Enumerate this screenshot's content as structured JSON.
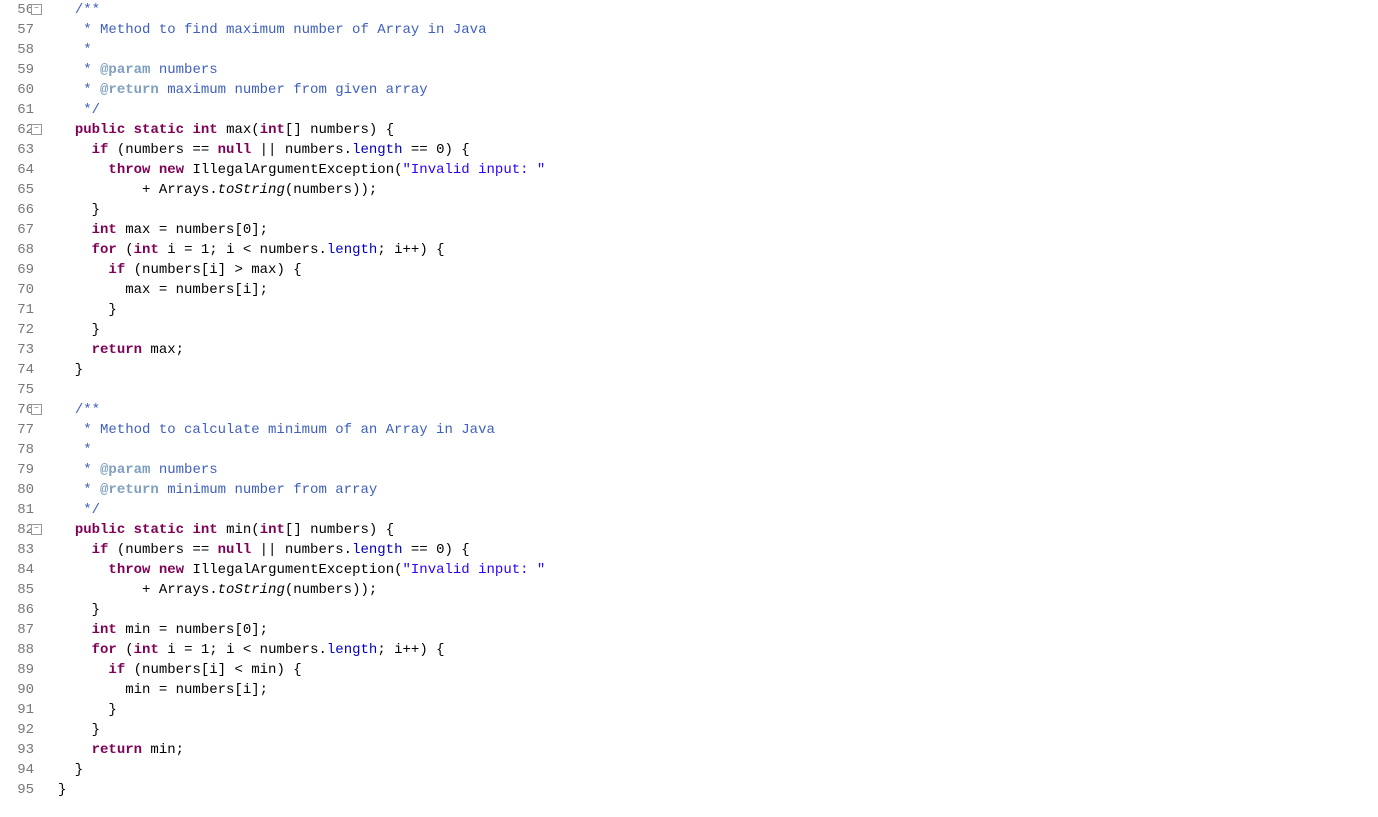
{
  "gutter": {
    "start": 56,
    "end": 95,
    "foldable": [
      56,
      62,
      76,
      82
    ]
  },
  "lines": {
    "56": [
      {
        "t": "  ",
        "c": ""
      },
      {
        "t": "/**",
        "c": "javadoc"
      }
    ],
    "57": [
      {
        "t": "   * Method to find maximum number of Array in Java",
        "c": "javadoc"
      }
    ],
    "58": [
      {
        "t": "   * ",
        "c": "javadoc"
      }
    ],
    "59": [
      {
        "t": "   * ",
        "c": "javadoc"
      },
      {
        "t": "@param",
        "c": "javadoc-tag"
      },
      {
        "t": " numbers",
        "c": "javadoc"
      }
    ],
    "60": [
      {
        "t": "   * ",
        "c": "javadoc"
      },
      {
        "t": "@return",
        "c": "javadoc-tag"
      },
      {
        "t": " maximum number from given array",
        "c": "javadoc"
      }
    ],
    "61": [
      {
        "t": "   */",
        "c": "javadoc"
      }
    ],
    "62": [
      {
        "t": "  ",
        "c": ""
      },
      {
        "t": "public",
        "c": "keyword"
      },
      {
        "t": " ",
        "c": ""
      },
      {
        "t": "static",
        "c": "keyword"
      },
      {
        "t": " ",
        "c": ""
      },
      {
        "t": "int",
        "c": "keyword"
      },
      {
        "t": " max(",
        "c": ""
      },
      {
        "t": "int",
        "c": "keyword"
      },
      {
        "t": "[] numbers) {",
        "c": ""
      }
    ],
    "63": [
      {
        "t": "    ",
        "c": ""
      },
      {
        "t": "if",
        "c": "keyword"
      },
      {
        "t": " (numbers == ",
        "c": ""
      },
      {
        "t": "null",
        "c": "keyword"
      },
      {
        "t": " || numbers.",
        "c": ""
      },
      {
        "t": "length",
        "c": "field"
      },
      {
        "t": " == 0) {",
        "c": ""
      }
    ],
    "64": [
      {
        "t": "      ",
        "c": ""
      },
      {
        "t": "throw",
        "c": "keyword"
      },
      {
        "t": " ",
        "c": ""
      },
      {
        "t": "new",
        "c": "keyword"
      },
      {
        "t": " IllegalArgumentException(",
        "c": ""
      },
      {
        "t": "\"Invalid input: \"",
        "c": "string"
      }
    ],
    "65": [
      {
        "t": "          + Arrays.",
        "c": ""
      },
      {
        "t": "toString",
        "c": "method-italic"
      },
      {
        "t": "(numbers));",
        "c": ""
      }
    ],
    "66": [
      {
        "t": "    }",
        "c": ""
      }
    ],
    "67": [
      {
        "t": "    ",
        "c": ""
      },
      {
        "t": "int",
        "c": "keyword"
      },
      {
        "t": " max = numbers[0];",
        "c": ""
      }
    ],
    "68": [
      {
        "t": "    ",
        "c": ""
      },
      {
        "t": "for",
        "c": "keyword"
      },
      {
        "t": " (",
        "c": ""
      },
      {
        "t": "int",
        "c": "keyword"
      },
      {
        "t": " i = 1; i < numbers.",
        "c": ""
      },
      {
        "t": "length",
        "c": "field"
      },
      {
        "t": "; i++) {",
        "c": ""
      }
    ],
    "69": [
      {
        "t": "      ",
        "c": ""
      },
      {
        "t": "if",
        "c": "keyword"
      },
      {
        "t": " (numbers[i] > max) {",
        "c": ""
      }
    ],
    "70": [
      {
        "t": "        max = numbers[i];",
        "c": ""
      }
    ],
    "71": [
      {
        "t": "      }",
        "c": ""
      }
    ],
    "72": [
      {
        "t": "    }",
        "c": ""
      }
    ],
    "73": [
      {
        "t": "    ",
        "c": ""
      },
      {
        "t": "return",
        "c": "keyword"
      },
      {
        "t": " max;",
        "c": ""
      }
    ],
    "74": [
      {
        "t": "  }",
        "c": ""
      }
    ],
    "75": [
      {
        "t": "",
        "c": ""
      }
    ],
    "76": [
      {
        "t": "  ",
        "c": ""
      },
      {
        "t": "/**",
        "c": "javadoc"
      }
    ],
    "77": [
      {
        "t": "   * Method to calculate minimum of an Array in Java",
        "c": "javadoc"
      }
    ],
    "78": [
      {
        "t": "   * ",
        "c": "javadoc"
      }
    ],
    "79": [
      {
        "t": "   * ",
        "c": "javadoc"
      },
      {
        "t": "@param",
        "c": "javadoc-tag"
      },
      {
        "t": " numbers",
        "c": "javadoc"
      }
    ],
    "80": [
      {
        "t": "   * ",
        "c": "javadoc"
      },
      {
        "t": "@return",
        "c": "javadoc-tag"
      },
      {
        "t": " minimum number from array",
        "c": "javadoc"
      }
    ],
    "81": [
      {
        "t": "   */",
        "c": "javadoc"
      }
    ],
    "82": [
      {
        "t": "  ",
        "c": ""
      },
      {
        "t": "public",
        "c": "keyword"
      },
      {
        "t": " ",
        "c": ""
      },
      {
        "t": "static",
        "c": "keyword"
      },
      {
        "t": " ",
        "c": ""
      },
      {
        "t": "int",
        "c": "keyword"
      },
      {
        "t": " min(",
        "c": ""
      },
      {
        "t": "int",
        "c": "keyword"
      },
      {
        "t": "[] numbers) {",
        "c": ""
      }
    ],
    "83": [
      {
        "t": "    ",
        "c": ""
      },
      {
        "t": "if",
        "c": "keyword"
      },
      {
        "t": " (numbers == ",
        "c": ""
      },
      {
        "t": "null",
        "c": "keyword"
      },
      {
        "t": " || numbers.",
        "c": ""
      },
      {
        "t": "length",
        "c": "field"
      },
      {
        "t": " == 0) {",
        "c": ""
      }
    ],
    "84": [
      {
        "t": "      ",
        "c": ""
      },
      {
        "t": "throw",
        "c": "keyword"
      },
      {
        "t": " ",
        "c": ""
      },
      {
        "t": "new",
        "c": "keyword"
      },
      {
        "t": " IllegalArgumentException(",
        "c": ""
      },
      {
        "t": "\"Invalid input: \"",
        "c": "string"
      }
    ],
    "85": [
      {
        "t": "          + Arrays.",
        "c": ""
      },
      {
        "t": "toString",
        "c": "method-italic"
      },
      {
        "t": "(numbers));",
        "c": ""
      }
    ],
    "86": [
      {
        "t": "    }",
        "c": ""
      }
    ],
    "87": [
      {
        "t": "    ",
        "c": ""
      },
      {
        "t": "int",
        "c": "keyword"
      },
      {
        "t": " min = numbers[0];",
        "c": ""
      }
    ],
    "88": [
      {
        "t": "    ",
        "c": ""
      },
      {
        "t": "for",
        "c": "keyword"
      },
      {
        "t": " (",
        "c": ""
      },
      {
        "t": "int",
        "c": "keyword"
      },
      {
        "t": " i = 1; i < numbers.",
        "c": ""
      },
      {
        "t": "length",
        "c": "field"
      },
      {
        "t": "; i++) {",
        "c": ""
      }
    ],
    "89": [
      {
        "t": "      ",
        "c": ""
      },
      {
        "t": "if",
        "c": "keyword"
      },
      {
        "t": " (numbers[i] < min) {",
        "c": ""
      }
    ],
    "90": [
      {
        "t": "        min = numbers[i];",
        "c": ""
      }
    ],
    "91": [
      {
        "t": "      }",
        "c": ""
      }
    ],
    "92": [
      {
        "t": "    }",
        "c": ""
      }
    ],
    "93": [
      {
        "t": "    ",
        "c": ""
      },
      {
        "t": "return",
        "c": "keyword"
      },
      {
        "t": " min;",
        "c": ""
      }
    ],
    "94": [
      {
        "t": "  }",
        "c": ""
      }
    ],
    "95": [
      {
        "t": "}",
        "c": ""
      }
    ]
  }
}
